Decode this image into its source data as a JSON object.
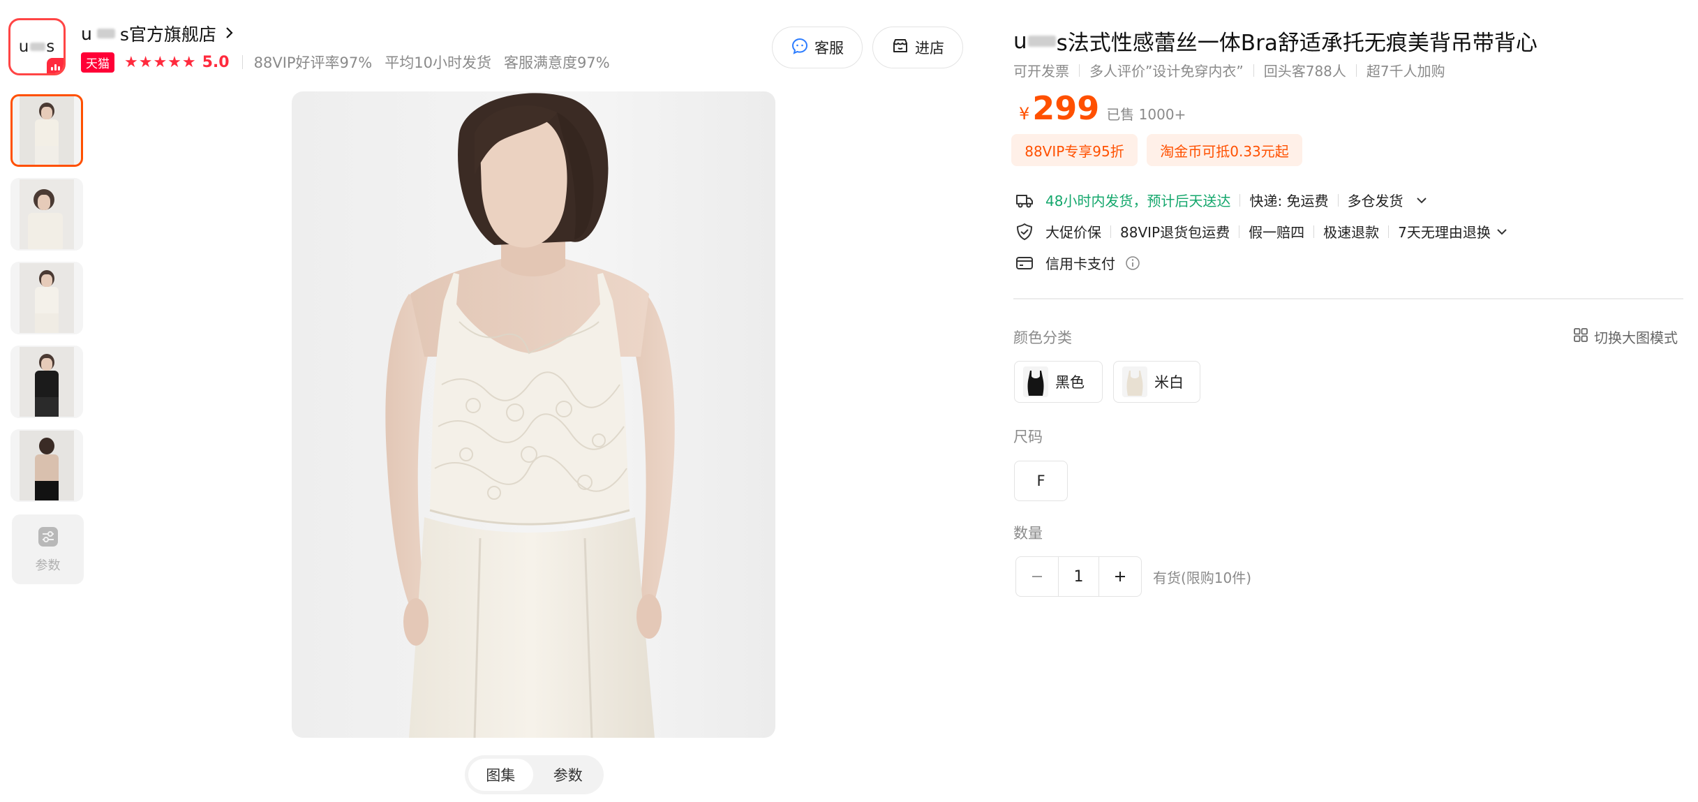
{
  "store": {
    "logo_prefix": "u",
    "logo_suffix": "s",
    "name_prefix": "u",
    "name_suffix": "s官方旗舰店",
    "tmall_label": "天猫",
    "stars": "★★★★★",
    "score": "5.0",
    "vip_rate": "88VIP好评率97%",
    "ship_time": "平均10小时发货",
    "service_rate": "客服满意度97%",
    "service_button": "客服",
    "shop_button": "进店"
  },
  "gallery": {
    "params_label": "参数",
    "tabs": [
      {
        "label": "图集"
      },
      {
        "label": "参数"
      }
    ]
  },
  "product": {
    "title_prefix": "u",
    "title_suffix": "s法式性感蕾丝一体Bra舒适承托无痕美背吊带背心",
    "tags": [
      "可开发票",
      "多人评价”设计免穿内衣”",
      "回头客788人",
      "超7千人加购"
    ],
    "currency": "¥",
    "price": "299",
    "sold": "已售 1000+",
    "promos": [
      "88VIP专享95折",
      "淘金币可抵0.33元起"
    ]
  },
  "delivery": {
    "eta": "48小时内发货，预计后天送达",
    "express": "快递: 免运费",
    "warehouse": "多仓发货"
  },
  "guarantees": {
    "items": [
      "大促价保",
      "88VIP退货包运费",
      "假一赔四",
      "极速退款",
      "7天无理由退换"
    ]
  },
  "payment": {
    "label": "信用卡支付"
  },
  "options": {
    "color_label": "颜色分类",
    "switch_view": "切换大图模式",
    "colors": [
      {
        "label": "黑色"
      },
      {
        "label": "米白"
      }
    ],
    "size_label": "尺码",
    "sizes": [
      "F"
    ],
    "qty_label": "数量",
    "qty_value": "1",
    "stock": "有货(限购10件)"
  }
}
